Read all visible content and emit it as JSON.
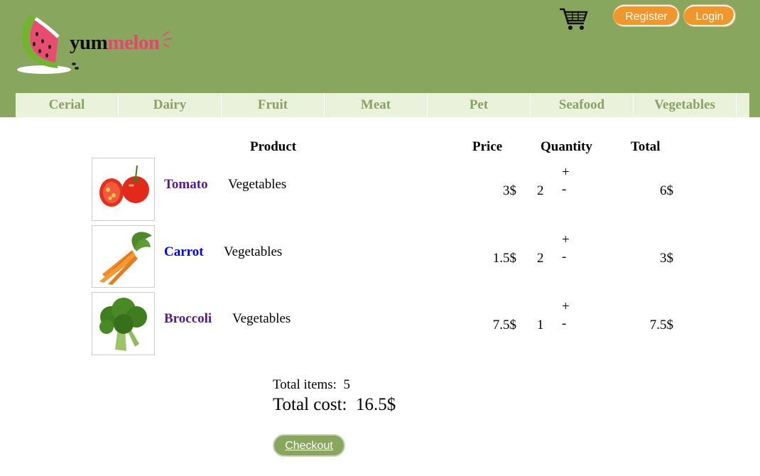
{
  "brand": {
    "part1": "yum",
    "part2": "melon",
    "accent": "#e0496b",
    "header_bg": "#88a65e"
  },
  "header": {
    "cart_icon": "shopping-cart-icon",
    "register_label": "Register",
    "login_label": "Login"
  },
  "nav": [
    "Cerial",
    "Dairy",
    "Fruit",
    "Meat",
    "Pet",
    "Seafood",
    "Vegetables"
  ],
  "cart_table": {
    "headers": {
      "product": "Product",
      "price": "Price",
      "quantity": "Quantity",
      "total": "Total"
    },
    "rows": [
      {
        "name": "Tomato",
        "category": "Vegetables",
        "price": "3$",
        "qty": "2",
        "total": "6$",
        "plus": "+",
        "minus": "-",
        "link_color": "#551a8b",
        "image": "tomato-image"
      },
      {
        "name": "Carrot",
        "category": "Vegetables",
        "price": "1.5$",
        "qty": "2",
        "total": "3$",
        "plus": "+",
        "minus": "-",
        "link_color": "#0000ee",
        "image": "carrot-image"
      },
      {
        "name": "Broccoli",
        "category": "Vegetables",
        "price": "7.5$",
        "qty": "1",
        "total": "7.5$",
        "plus": "+",
        "minus": "-",
        "link_color": "#551a8b",
        "image": "broccoli-image"
      }
    ]
  },
  "summary": {
    "items_label": "Total items:",
    "items_value": "5",
    "cost_label": "Total cost:",
    "cost_value": "16.5$"
  },
  "checkout_label": "Checkout"
}
